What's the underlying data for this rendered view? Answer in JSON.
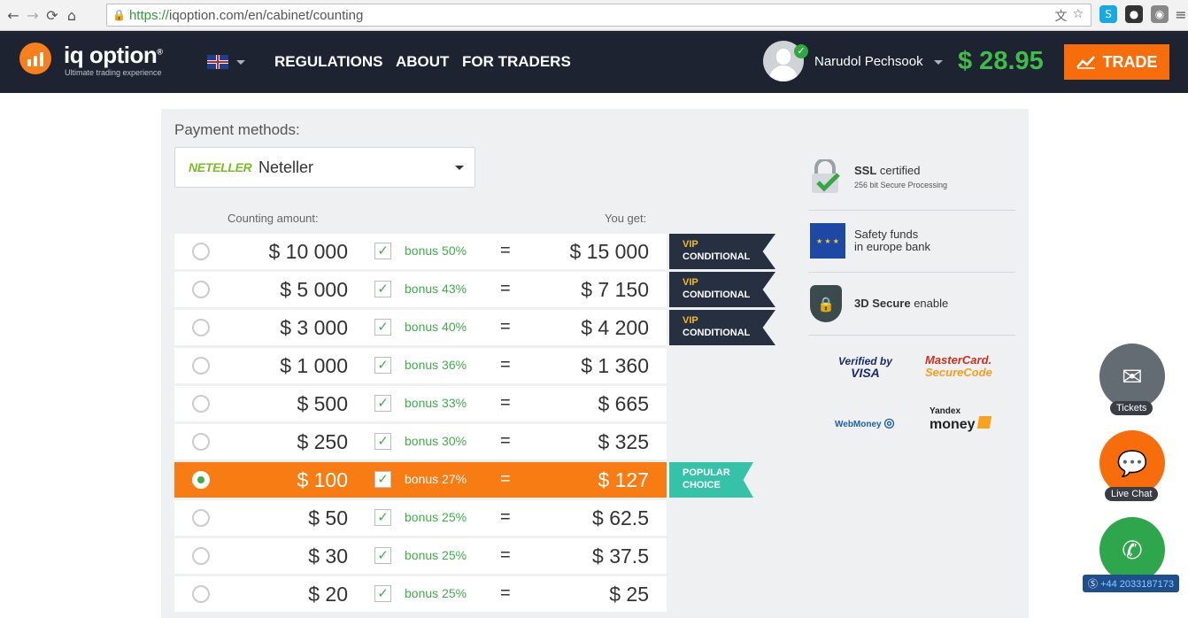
{
  "browser": {
    "url_scheme": "https://",
    "url_rest": "iqoption.com/en/cabinet/counting"
  },
  "header": {
    "logo_text": "iq option",
    "logo_reg": "®",
    "logo_sub": "Ultimate trading experience",
    "nav": [
      "REGULATIONS",
      "ABOUT",
      "FOR TRADERS"
    ],
    "username": "Narudol Pechsook",
    "balance": "$ 28.95",
    "trade_label": "TRADE"
  },
  "payment": {
    "label": "Payment methods:",
    "method_logo": "NETELLER",
    "method_name": "Neteller"
  },
  "table": {
    "col_amount": "Counting amount:",
    "col_get": "You get:",
    "rows": [
      {
        "amount": "$ 10 000",
        "bonus": "bonus 50%",
        "eq": "=",
        "get": "$ 15 000",
        "selected": false,
        "badge": "vip"
      },
      {
        "amount": "$ 5 000",
        "bonus": "bonus 43%",
        "eq": "=",
        "get": "$ 7 150",
        "selected": false,
        "badge": "vip"
      },
      {
        "amount": "$ 3 000",
        "bonus": "bonus 40%",
        "eq": "=",
        "get": "$ 4 200",
        "selected": false,
        "badge": "vip"
      },
      {
        "amount": "$ 1 000",
        "bonus": "bonus 36%",
        "eq": "=",
        "get": "$ 1 360",
        "selected": false,
        "badge": ""
      },
      {
        "amount": "$ 500",
        "bonus": "bonus 33%",
        "eq": "=",
        "get": "$ 665",
        "selected": false,
        "badge": ""
      },
      {
        "amount": "$ 250",
        "bonus": "bonus 30%",
        "eq": "=",
        "get": "$ 325",
        "selected": false,
        "badge": ""
      },
      {
        "amount": "$ 100",
        "bonus": "bonus 27%",
        "eq": "=",
        "get": "$ 127",
        "selected": true,
        "badge": "popular"
      },
      {
        "amount": "$ 50",
        "bonus": "bonus 25%",
        "eq": "=",
        "get": "$ 62.5",
        "selected": false,
        "badge": ""
      },
      {
        "amount": "$ 30",
        "bonus": "bonus 25%",
        "eq": "=",
        "get": "$ 37.5",
        "selected": false,
        "badge": ""
      },
      {
        "amount": "$ 20",
        "bonus": "bonus 25%",
        "eq": "=",
        "get": "$ 25",
        "selected": false,
        "badge": ""
      }
    ],
    "badge_vip_top": "VIP",
    "badge_vip_bottom": "CONDITIONAL",
    "badge_popular_top": "POPULAR",
    "badge_popular_bottom": "CHOICE"
  },
  "security": {
    "ssl_title": "SSL",
    "ssl_title_rest": " certified",
    "ssl_sub": "256 bit Secure Processing",
    "funds_line1": "Safety funds",
    "funds_line2": "in europe bank",
    "secure_title": "3D Secure",
    "secure_rest": " enable",
    "visa_line1": "Verified by",
    "visa_line2": "VISA",
    "mc_line1": "MasterCard.",
    "mc_line2": "SecureCode",
    "webmoney": "WebMoney",
    "yandex_line1": "Yandex",
    "yandex_line2": "money"
  },
  "floating": {
    "tickets": "Tickets",
    "live_chat": "Live Chat",
    "phone": "+44 2033187173"
  },
  "colors": {
    "header_bg": "#1d2330",
    "accent_orange": "#f76d0c",
    "balance_green": "#3fbd4a",
    "popular_teal": "#35c2a8"
  }
}
